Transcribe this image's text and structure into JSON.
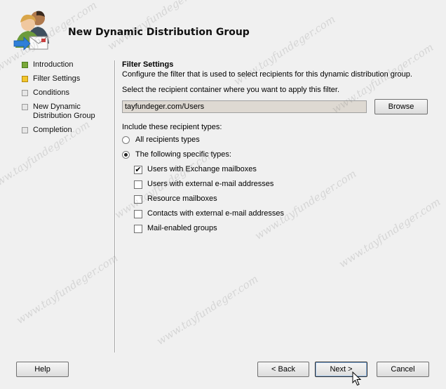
{
  "header": {
    "title": "New Dynamic Distribution Group"
  },
  "nav": {
    "items": [
      {
        "label": "Introduction",
        "state": "done"
      },
      {
        "label": "Filter Settings",
        "state": "current"
      },
      {
        "label": "Conditions",
        "state": "pending"
      },
      {
        "label": "New Dynamic Distribution Group",
        "state": "pending"
      },
      {
        "label": "Completion",
        "state": "pending"
      }
    ]
  },
  "filter": {
    "title": "Filter Settings",
    "description": "Configure the filter that is used to select recipients for this dynamic distribution group.",
    "container_prompt": "Select the recipient container where you want to apply this filter.",
    "container_value": "tayfundeger.com/Users",
    "browse_label": "Browse",
    "types_prompt": "Include these recipient types:",
    "radio_all": "All recipients types",
    "radio_specific": "The following specific types:",
    "checkboxes": [
      {
        "label": "Users with Exchange mailboxes",
        "checked": true
      },
      {
        "label": "Users with external e-mail addresses",
        "checked": false
      },
      {
        "label": "Resource mailboxes",
        "checked": false
      },
      {
        "label": "Contacts with external e-mail addresses",
        "checked": false
      },
      {
        "label": "Mail-enabled groups",
        "checked": false
      }
    ]
  },
  "footer": {
    "help": "Help",
    "back": "< Back",
    "next": "Next >",
    "cancel": "Cancel"
  },
  "watermark": {
    "text": "www.tayfundeger.com"
  },
  "colors": {
    "background": "#f0f0f0",
    "field_readonly": "#ded9d2",
    "step_done": "#7aa83a",
    "step_current": "#f2c62c"
  }
}
